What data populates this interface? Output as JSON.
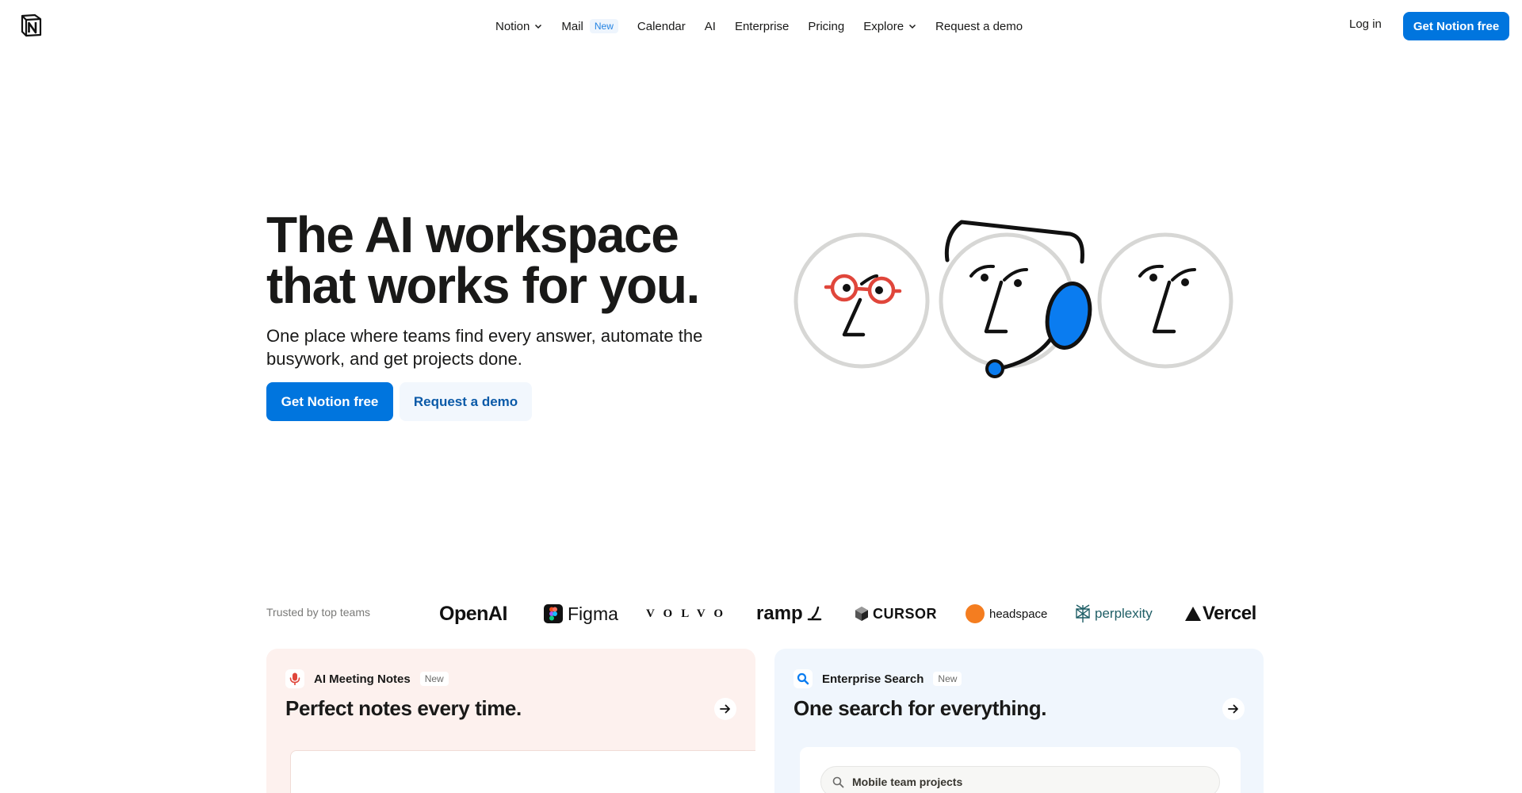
{
  "nav": {
    "links": [
      {
        "label": "Notion",
        "has_dropdown": true
      },
      {
        "label": "Mail",
        "badge": "New"
      },
      {
        "label": "Calendar"
      },
      {
        "label": "AI"
      },
      {
        "label": "Enterprise"
      },
      {
        "label": "Pricing"
      },
      {
        "label": "Explore",
        "has_dropdown": true
      },
      {
        "label": "Request a demo"
      }
    ],
    "login": "Log in",
    "cta": "Get Notion free"
  },
  "hero": {
    "title_line1": "The AI workspace",
    "title_line2": "that works for you.",
    "subtitle": "One place where teams find every answer, automate the busywork, and get projects done.",
    "primary_button": "Get Notion free",
    "secondary_button": "Request a demo"
  },
  "trusted": {
    "label": "Trusted by top teams",
    "logos": [
      "OpenAI",
      "Figma",
      "VOLVO",
      "ramp",
      "CURSOR",
      "headspace",
      "perplexity",
      "Vercel"
    ]
  },
  "cards": [
    {
      "label": "AI Meeting Notes",
      "badge": "New",
      "title": "Perfect notes every time."
    },
    {
      "label": "Enterprise Search",
      "badge": "New",
      "title": "One search for everything.",
      "search_text": "Mobile team projects"
    }
  ],
  "colors": {
    "primary": "#0075de",
    "text": "#191918",
    "accent_red": "#e0463b",
    "accent_blue": "#0a7cf0",
    "card_left_bg": "#fdf1ee",
    "card_right_bg": "#f0f6fd"
  }
}
